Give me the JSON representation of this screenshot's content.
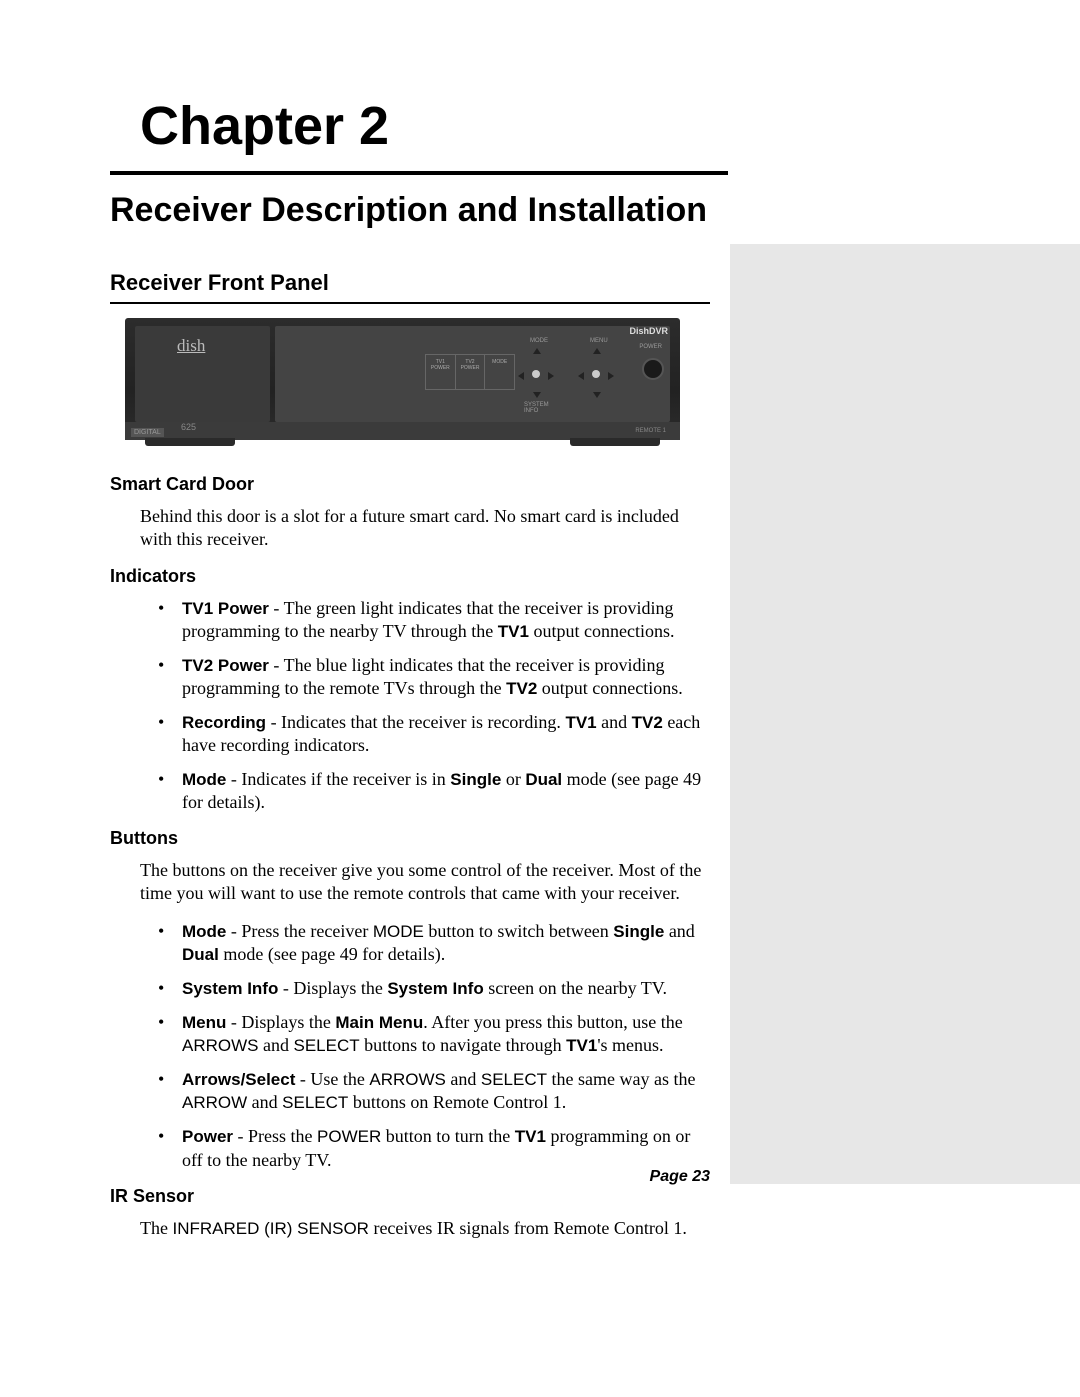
{
  "chapter": "Chapter 2",
  "title": "Receiver Description and Installation",
  "section": "Receiver Front Panel",
  "device": {
    "logo": "dish",
    "model": "625",
    "dvr": "DishDVR",
    "remote": "REMOTE 1",
    "bottom": "DIGITAL",
    "ind": {
      "a": "TV1 POWER",
      "b": "TV2 POWER",
      "c": "MODE"
    },
    "lbl_mode": "MODE",
    "lbl_menu": "MENU",
    "lbl_sys": "SYSTEM INFO",
    "lbl_power": "POWER"
  },
  "smartcard": {
    "heading": "Smart Card Door",
    "text": "Behind this door is a slot for a future smart card. No smart card is included with this receiver."
  },
  "indicators": {
    "heading": "Indicators",
    "items": [
      {
        "label": "TV1 Power",
        "pre": " - The green light indicates that the receiver is providing programming to the nearby TV through the ",
        "bold1": "TV1",
        "post": " output connections."
      },
      {
        "label": "TV2 Power",
        "pre": " - The blue light indicates that the receiver is providing programming to the remote TVs through the ",
        "bold1": "TV2",
        "post": " output connections."
      },
      {
        "label": "Recording",
        "pre": " - Indicates that the receiver is recording. ",
        "bold1": "TV1",
        "mid": " and ",
        "bold2": "TV2",
        "post": " each have recording indicators."
      },
      {
        "label": "Mode",
        "pre": " - Indicates if the receiver is in ",
        "bold1": "Single",
        "mid": " or ",
        "bold2": "Dual",
        "post": " mode (see page 49 for details)."
      }
    ]
  },
  "buttons": {
    "heading": "Buttons",
    "intro": "The buttons on the receiver give you some control of the receiver. Most of the time you will want to use the remote controls that came with your receiver.",
    "items": [
      {
        "label": "Mode",
        "t1": " - Press the receiver ",
        "sc1": "MODE",
        "t2": " button to switch between ",
        "b1": "Single",
        "t3": " and ",
        "b2": "Dual",
        "t4": " mode (see page 49 for details)."
      },
      {
        "label": "System Info",
        "t1": " - Displays the ",
        "b1": "System Info",
        "t2": " screen on the nearby TV."
      },
      {
        "label": "Menu",
        "t1": " - Displays the ",
        "b1": "Main Menu",
        "t2": ". After you press this button, use the ",
        "sc1": "ARROWS",
        "t3": " and ",
        "sc2": "SELECT",
        "t4": " buttons to navigate through ",
        "b2": "TV1",
        "t5": "'s menus."
      },
      {
        "label": "Arrows/Select",
        "t1": " - Use the ",
        "sc1": "ARROWS",
        "t2": " and ",
        "sc2": "SELECT",
        "t3": " the same way as the ",
        "sc3": "ARROW",
        "t4": " and ",
        "sc4": "SELECT",
        "t5": " buttons on Remote Control 1."
      },
      {
        "label": "Power",
        "t1": " - Press the ",
        "sc1": "POWER",
        "t2": " button to turn the ",
        "b1": "TV1",
        "t3": " programming on or off to the nearby TV."
      }
    ]
  },
  "ir": {
    "heading": "IR Sensor",
    "t1": "The ",
    "sc1": "INFRARED (IR) SENSOR",
    "t2": " receives IR signals from Remote Control 1."
  },
  "page": "Page 23"
}
